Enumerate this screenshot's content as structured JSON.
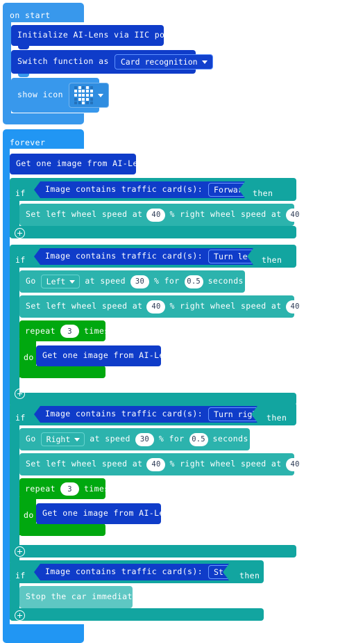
{
  "palette": {
    "event_light_blue": "#3898ec",
    "ailens_dark_blue": "#0f3cc9",
    "loops_green": "#00a80f",
    "logic_teal": "#12a5a0",
    "motor_teal": "#2cb3ad",
    "white": "#ffffff"
  },
  "workspace": {
    "scripts": [
      {
        "id": "on-start",
        "type": "event",
        "label": "on start",
        "children": [
          {
            "id": "init-ailens",
            "type": "statement",
            "label": "Initialize AI-Lens via IIC port"
          },
          {
            "id": "switch-function",
            "type": "statement",
            "label": "Switch function as",
            "dropdown": {
              "value": "Card recognition",
              "icon": "chevron-down-icon"
            }
          },
          {
            "id": "show-icon",
            "type": "statement",
            "label": "show icon",
            "led_matrix": {
              "icon": "heart-icon",
              "rows": [
                [
                  0,
                  1,
                  0,
                  1,
                  0
                ],
                [
                  1,
                  1,
                  1,
                  1,
                  1
                ],
                [
                  1,
                  1,
                  1,
                  1,
                  1
                ],
                [
                  0,
                  1,
                  1,
                  1,
                  0
                ],
                [
                  0,
                  0,
                  1,
                  0,
                  0
                ]
              ]
            },
            "dropdown": {
              "value": "",
              "icon": "chevron-down-icon"
            }
          }
        ]
      },
      {
        "id": "forever",
        "type": "event",
        "label": "forever",
        "children": [
          {
            "id": "get-image-1",
            "type": "statement",
            "label": "Get one image from AI-Lens"
          },
          {
            "id": "if-forward",
            "type": "conditional",
            "if_label": "if",
            "then_label": "then",
            "condition": {
              "label": "Image contains traffic card(s):",
              "dropdown": {
                "value": "Forward",
                "icon": "chevron-down-icon"
              }
            },
            "plus_label": "add-condition",
            "children": [
              {
                "id": "set-wheels-1",
                "type": "statement",
                "parts": [
                  {
                    "kind": "text",
                    "text": "Set left wheel speed at"
                  },
                  {
                    "kind": "number",
                    "value": "40"
                  },
                  {
                    "kind": "text",
                    "text": "% right wheel speed at"
                  },
                  {
                    "kind": "number",
                    "value": "40"
                  },
                  {
                    "kind": "text",
                    "text": "%"
                  }
                ]
              }
            ]
          },
          {
            "id": "if-turn-left",
            "type": "conditional",
            "if_label": "if",
            "then_label": "then",
            "condition": {
              "label": "Image contains traffic card(s):",
              "dropdown": {
                "value": "Turn left",
                "icon": "chevron-down-icon"
              }
            },
            "plus_label": "add-condition",
            "children": [
              {
                "id": "go-left",
                "type": "statement",
                "parts": [
                  {
                    "kind": "text",
                    "text": "Go"
                  },
                  {
                    "kind": "dropdown",
                    "value": "Left"
                  },
                  {
                    "kind": "text",
                    "text": "at speed"
                  },
                  {
                    "kind": "number",
                    "value": "30"
                  },
                  {
                    "kind": "text",
                    "text": "% for"
                  },
                  {
                    "kind": "number",
                    "value": "0.5"
                  },
                  {
                    "kind": "text",
                    "text": "seconds"
                  }
                ]
              },
              {
                "id": "set-wheels-2",
                "type": "statement",
                "parts": [
                  {
                    "kind": "text",
                    "text": "Set left wheel speed at"
                  },
                  {
                    "kind": "number",
                    "value": "40"
                  },
                  {
                    "kind": "text",
                    "text": "% right wheel speed at"
                  },
                  {
                    "kind": "number",
                    "value": "40"
                  },
                  {
                    "kind": "text",
                    "text": "%"
                  }
                ]
              },
              {
                "id": "repeat-1",
                "type": "loop",
                "repeat_label": "repeat",
                "times_label": "times",
                "do_label": "do",
                "count": "3",
                "children": [
                  {
                    "id": "get-image-2",
                    "type": "statement",
                    "label": "Get one image from AI-Lens"
                  }
                ]
              }
            ]
          },
          {
            "id": "if-turn-right",
            "type": "conditional",
            "if_label": "if",
            "then_label": "then",
            "condition": {
              "label": "Image contains traffic card(s):",
              "dropdown": {
                "value": "Turn right",
                "icon": "chevron-down-icon"
              }
            },
            "plus_label": "add-condition",
            "children": [
              {
                "id": "go-right",
                "type": "statement",
                "parts": [
                  {
                    "kind": "text",
                    "text": "Go"
                  },
                  {
                    "kind": "dropdown",
                    "value": "Right"
                  },
                  {
                    "kind": "text",
                    "text": "at speed"
                  },
                  {
                    "kind": "number",
                    "value": "30"
                  },
                  {
                    "kind": "text",
                    "text": "% for"
                  },
                  {
                    "kind": "number",
                    "value": "0.5"
                  },
                  {
                    "kind": "text",
                    "text": "seconds"
                  }
                ]
              },
              {
                "id": "set-wheels-3",
                "type": "statement",
                "parts": [
                  {
                    "kind": "text",
                    "text": "Set left wheel speed at"
                  },
                  {
                    "kind": "number",
                    "value": "40"
                  },
                  {
                    "kind": "text",
                    "text": "% right wheel speed at"
                  },
                  {
                    "kind": "number",
                    "value": "40"
                  },
                  {
                    "kind": "text",
                    "text": "%"
                  }
                ]
              },
              {
                "id": "repeat-2",
                "type": "loop",
                "repeat_label": "repeat",
                "times_label": "times",
                "do_label": "do",
                "count": "3",
                "children": [
                  {
                    "id": "get-image-3",
                    "type": "statement",
                    "label": "Get one image from AI-Lens"
                  }
                ]
              }
            ]
          },
          {
            "id": "if-stop",
            "type": "conditional",
            "if_label": "if",
            "then_label": "then",
            "condition": {
              "label": "Image contains traffic card(s):",
              "dropdown": {
                "value": "Stop",
                "icon": "chevron-down-icon"
              }
            },
            "plus_label": "add-condition",
            "children": [
              {
                "id": "stop-car",
                "type": "statement",
                "label": "Stop the car immediately"
              }
            ]
          }
        ]
      }
    ]
  },
  "strings": {
    "on_start": "on start",
    "forever": "forever",
    "init_ailens": "Initialize AI-Lens via IIC port",
    "switch_function": "Switch function as",
    "card_recognition": "Card recognition",
    "show_icon": "show icon",
    "get_image": "Get one image from AI-Lens",
    "if": "if",
    "then": "then",
    "cond_label": "Image contains traffic card(s):",
    "forward": "Forward",
    "turn_left": "Turn left",
    "turn_right": "Turn right",
    "stop": "Stop",
    "set_wheel_a": "Set left wheel speed at",
    "set_wheel_b": "% right wheel speed at",
    "percent": "%",
    "go": "Go",
    "left": "Left",
    "right": "Right",
    "at_speed": "at speed",
    "pct_for": "% for",
    "seconds": "seconds",
    "repeat": "repeat",
    "times": "times",
    "do": "do",
    "stop_car": "Stop the car immediately",
    "n40": "40",
    "n30": "30",
    "n05": "0.5",
    "n3": "3"
  }
}
